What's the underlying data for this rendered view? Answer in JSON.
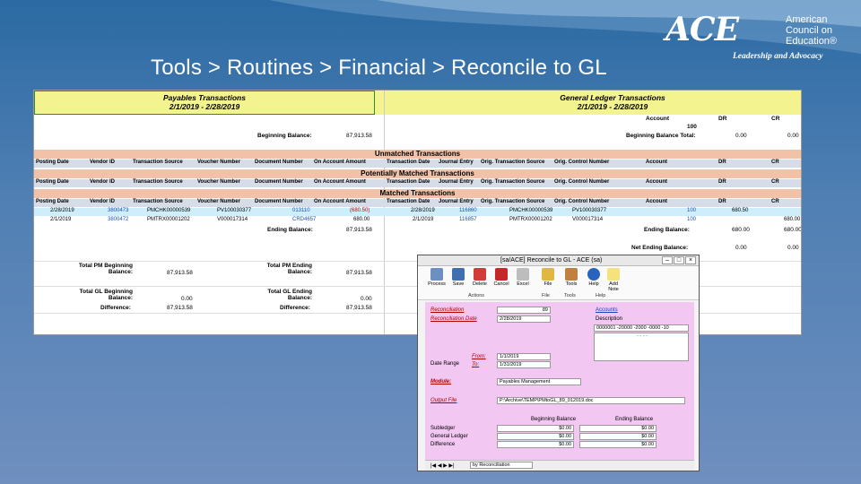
{
  "slide": {
    "title": "Tools > Routines > Financial > Reconcile to GL",
    "logo": {
      "mark": "ACE",
      "line1": "American",
      "line2": "Council on",
      "line3": "Education®",
      "tagline": "Leadership and Advocacy"
    }
  },
  "sheet": {
    "payables_title": "Payables Transactions",
    "payables_range": "2/1/2019 - 2/28/2019",
    "gl_title": "General Ledger Transactions",
    "gl_range": "2/1/2019 - 2/28/2019",
    "acct_hdr": {
      "account": "Account",
      "dr": "DR",
      "cr": "CR"
    },
    "acct_value": "100",
    "beginning_balance_label": "Beginning Balance:",
    "beginning_balance_value": "87,913.58",
    "beginning_balance_total_label": "Beginning Balance Total:",
    "beginning_balance_total_dr": "0.00",
    "beginning_balance_total_cr": "0.00",
    "sections": {
      "unmatched": "Unmatched Transactions",
      "potential": "Potentially Matched Transactions",
      "matched": "Matched Transactions"
    },
    "left_headers": [
      "Posting Date",
      "Vendor ID",
      "Transaction Source",
      "Voucher Number",
      "Document Number",
      "On Account Amount"
    ],
    "right_headers": [
      "Transaction Date",
      "Journal Entry",
      "Orig. Transaction Source",
      "Orig. Control Number",
      "Account",
      "DR",
      "CR"
    ],
    "matched_rows": [
      {
        "posting": "2/28/2019",
        "vendor": "3800473",
        "source": "PMCHK00000539",
        "voucher": "PV100030377",
        "document": "013110",
        "amount": "(680.50)",
        "tdate": "2/28/2019",
        "je": "116860",
        "osource": "PMCHK00000539",
        "octrl": "PV100030377",
        "acct": "100",
        "dr": "680.50",
        "cr": ""
      },
      {
        "posting": "2/1/2019",
        "vendor": "3800472",
        "source": "PMTRX00001202",
        "voucher": "V000017314",
        "document": "CRD4657",
        "amount": "680.00",
        "tdate": "2/1/2019",
        "je": "116857",
        "osource": "PMTRX00001202",
        "octrl": "V000017314",
        "acct": "100",
        "dr": "",
        "cr": "680.00"
      }
    ],
    "ending_balance_label": "Ending Balance:",
    "ending_balance_value": "87,913.58",
    "gl_ending_label": "Ending Balance:",
    "gl_ending_dr": "680.00",
    "gl_ending_cr": "680.00",
    "net_ending_label": "Net Ending Balance:",
    "net_ending_dr": "0.00",
    "net_ending_cr": "0.00",
    "totals": {
      "pm_begin_label1": "Total PM Beginning",
      "pm_begin_label2": "Balance:",
      "pm_begin_value": "87,913.58",
      "pm_end_label1": "Total PM Ending",
      "pm_end_label2": "Balance:",
      "pm_end_value": "87,913.58",
      "gl_begin_label1": "Total GL Beginning",
      "gl_begin_label2": "Balance:",
      "gl_begin_value": "0.00",
      "gl_end_label1": "Total GL Ending",
      "gl_end_label2": "Balance:",
      "gl_end_value": "0.00",
      "diff_label": "Difference:",
      "diff_value_left": "87,913.58",
      "diff_value_right": "87,913.58"
    }
  },
  "dialog": {
    "title": "[sa/ACE] Reconcile to GL  -  ACE (sa)",
    "buttons": [
      "Process",
      "Save",
      "Delete",
      "Cancel",
      "Excel",
      "File",
      "Tools",
      "Help",
      "Add Note"
    ],
    "groups": [
      "Actions",
      "File",
      "Tools",
      "Help"
    ],
    "reconciliation_label": "Reconciliation",
    "reconciliation_value": "89",
    "reconciliation_date_label": "Reconciliation Date",
    "reconciliation_date_value": "2/28/2019",
    "accounts_label": "Accounts",
    "description_label": "Description",
    "account_value": "0000001 -20000 -2000 -0000 -10",
    "account_mask": "-   -   -   -",
    "date_range_label": "Date Range",
    "from_label": "From:",
    "from_value": "1/1/2019",
    "to_label": "To:",
    "to_value": "1/31/2019",
    "module_label": "Module:",
    "module_value": "Payables Management",
    "output_file_label": "Output File",
    "output_file_value": "P:\\Archive\\TEMP\\PMtoGL_89_012019.doc",
    "bal_headers": [
      "Beginning Balance",
      "Ending Balance"
    ],
    "bal_rows": [
      {
        "label": "Subledger",
        "begin": "$0.00",
        "end": "$0.00"
      },
      {
        "label": "General Ledger",
        "begin": "$0.00",
        "end": "$0.00"
      },
      {
        "label": "Difference",
        "begin": "$0.00",
        "end": "$0.00"
      }
    ],
    "sort_value": "by Reconciliation"
  },
  "colors": {
    "accent_yellow": "#f3f38f",
    "section_orange": "#f2c2a8",
    "header_gray": "#d6dde8",
    "matched_blue": "#cdeefa",
    "dialog_pink": "#f2c8f2"
  }
}
